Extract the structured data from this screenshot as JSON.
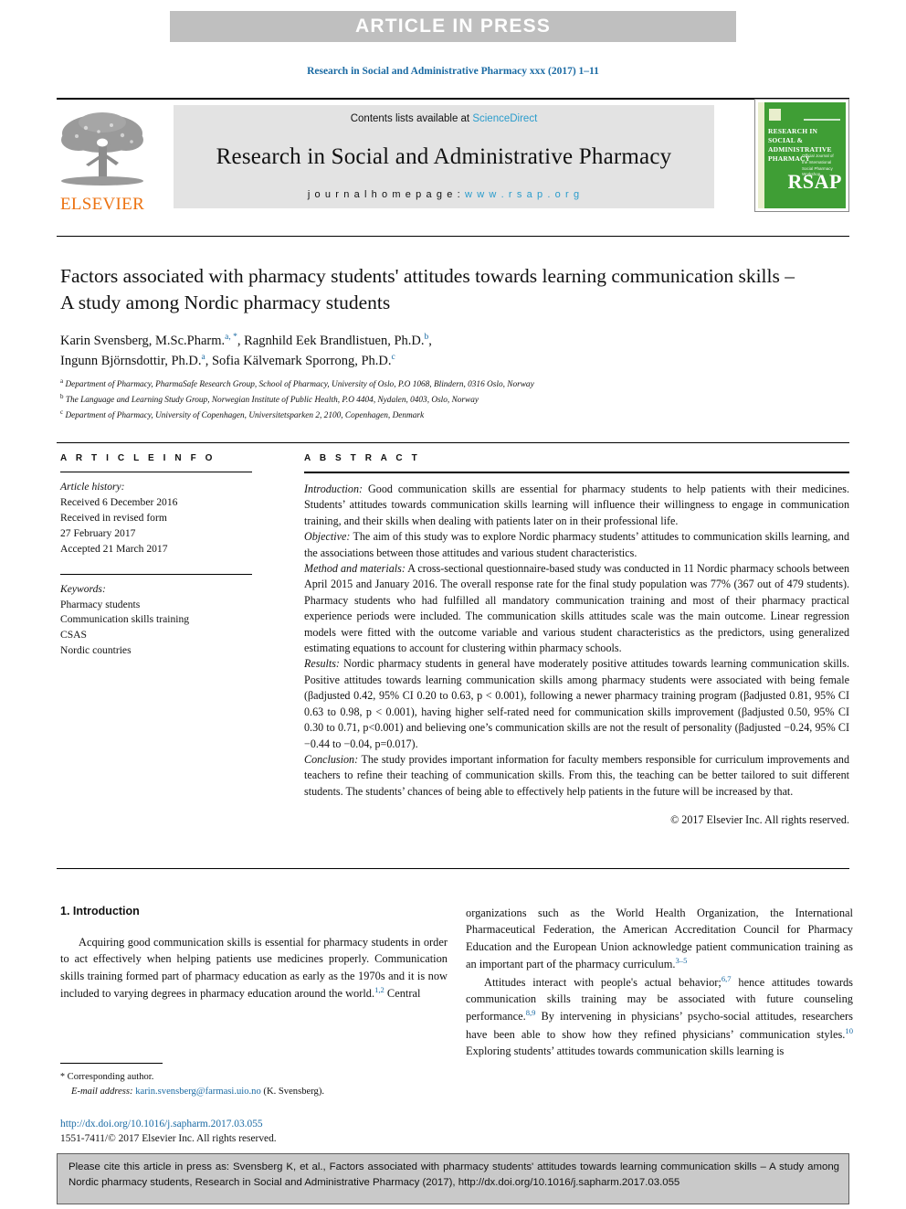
{
  "banner": {
    "text": "ARTICLE IN PRESS"
  },
  "running_head": "Research in Social and Administrative Pharmacy xxx (2017) 1–11",
  "masthead": {
    "contents_prefix": "Contents lists available at ",
    "sciencedirect": "ScienceDirect",
    "journal_title": "Research in Social and Administrative Pharmacy",
    "homepage_prefix": "j o u r n a l   h o m e p a g e :   ",
    "homepage_url": "w w w . r s a p . o r g",
    "publisher": "ELSEVIER",
    "cover": {
      "title": "RESEARCH IN SOCIAL & ADMINISTRATIVE PHARMACY",
      "subtitle": "Official Journal of the International Social Pharmacy Workshop",
      "acronym": "RSAP"
    },
    "colors": {
      "link_blue": "#2a9ccc",
      "elsevier_orange": "#ec7211",
      "cover_green": "#3f9e35",
      "banner_grey": "#bfbfbf"
    }
  },
  "article": {
    "title": "Factors associated with pharmacy students' attitudes towards learning communication skills – A study among Nordic pharmacy students",
    "authors_line_1_a": "Karin Svensberg, M.Sc.Pharm.",
    "authors_line_1_sup1": "a, *",
    "authors_line_1_b": ", Ragnhild Eek Brandlistuen, Ph.D.",
    "authors_line_1_sup2": "b",
    "authors_line_1_c": ",",
    "authors_line_2_a": "Ingunn Björnsdottir, Ph.D.",
    "authors_line_2_sup1": "a",
    "authors_line_2_b": ", Sofia Kälvemark Sporrong, Ph.D.",
    "authors_line_2_sup2": "c",
    "affiliations": [
      {
        "marker": "a",
        "text": "Department of Pharmacy, PharmaSafe Research Group, School of Pharmacy, University of Oslo, P.O 1068, Blindern, 0316 Oslo, Norway"
      },
      {
        "marker": "b",
        "text": "The Language and Learning Study Group, Norwegian Institute of Public Health, P.O 4404, Nydalen, 0403, Oslo, Norway"
      },
      {
        "marker": "c",
        "text": "Department of Pharmacy, University of Copenhagen, Universitetsparken 2, 2100, Copenhagen, Denmark"
      }
    ]
  },
  "article_info": {
    "heading": "A R T I C L E   I N F O",
    "history_label": "Article history:",
    "history": [
      "Received 6 December 2016",
      "Received in revised form",
      "27 February 2017",
      "Accepted 21 March 2017"
    ],
    "keywords_label": "Keywords:",
    "keywords": [
      "Pharmacy students",
      "Communication skills training",
      "CSAS",
      "Nordic countries"
    ]
  },
  "abstract": {
    "heading": "A B S T R A C T",
    "sections": [
      {
        "label": "Introduction:",
        "text": " Good communication skills are essential for pharmacy students to help patients with their medicines. Students’ attitudes towards communication skills learning will influence their willingness to engage in communication training, and their skills when dealing with patients later on in their professional life."
      },
      {
        "label": "Objective:",
        "text": " The aim of this study was to explore Nordic pharmacy students’ attitudes to communication skills learning, and the associations between those attitudes and various student characteristics."
      },
      {
        "label": "Method and materials:",
        "text": " A cross-sectional questionnaire-based study was conducted in 11 Nordic pharmacy schools between April 2015 and January 2016. The overall response rate for the final study population was 77% (367 out of 479 students). Pharmacy students who had fulfilled all mandatory communication training and most of their pharmacy practical experience periods were included. The communication skills attitudes scale was the main outcome. Linear regression models were fitted with the outcome variable and various student characteristics as the predictors, using generalized estimating equations to account for clustering within pharmacy schools."
      },
      {
        "label": "Results:",
        "text": " Nordic pharmacy students in general have moderately positive attitudes towards learning communication skills. Positive attitudes towards learning communication skills among pharmacy students were associated with being female (βadjusted 0.42, 95% CI 0.20 to 0.63, p < 0.001), following a newer pharmacy training program (βadjusted 0.81, 95% CI 0.63 to 0.98, p < 0.001), having higher self-rated need for communication skills improvement (βadjusted 0.50, 95% CI 0.30 to 0.71, p<0.001) and believing one’s communication skills are not the result of personality (βadjusted −0.24, 95% CI −0.44 to −0.04, p=0.017)."
      },
      {
        "label": "Conclusion:",
        "text": " The study provides important information for faculty members responsible for curriculum improvements and teachers to refine their teaching of communication skills. From this, the teaching can be better tailored to suit different students. The students’ chances of being able to effectively help patients in the future will be increased by that."
      }
    ],
    "copyright": "© 2017 Elsevier Inc. All rights reserved."
  },
  "introduction": {
    "heading": "1.  Introduction",
    "left_paragraph": "Acquiring good communication skills is essential for pharmacy students in order to act effectively when helping patients use medicines properly. Communication skills training formed part of pharmacy education as early as the 1970s and it is now included to varying degrees in pharmacy education around the world.",
    "left_ref": "1,2",
    "left_tail": " Central",
    "right_paragraph_1": "organizations such as the World Health Organization, the International Pharmaceutical Federation, the American Accreditation Council for Pharmacy Education and the European Union acknowledge patient communication training as an important part of the pharmacy curriculum.",
    "right_ref_1": "3–5",
    "right_paragraph_2a": "Attitudes interact with people's actual behavior;",
    "right_ref_2": "6,7",
    "right_paragraph_2b": " hence attitudes towards communication skills training may be associated with future counseling performance.",
    "right_ref_3": "8,9",
    "right_paragraph_2c": " By intervening in physicians’ psycho-social attitudes, researchers have been able to show how they refined physicians’ communication styles.",
    "right_ref_4": "10",
    "right_paragraph_2d": " Exploring students’ attitudes towards communication skills learning is"
  },
  "footnote": {
    "corresponding": "Corresponding author.",
    "email_label": "E-mail address:",
    "email": "karin.svensberg@farmasi.uio.no",
    "email_suffix": " (K. Svensberg)."
  },
  "doi_block": {
    "doi_url": "http://dx.doi.org/10.1016/j.sapharm.2017.03.055",
    "issn_line": "1551-7411/© 2017 Elsevier Inc. All rights reserved."
  },
  "cite_box": {
    "text": "Please cite this article in press as: Svensberg K, et al., Factors associated with pharmacy students' attitudes towards learning communication skills – A study among Nordic pharmacy students, Research in Social and Administrative Pharmacy (2017), http://dx.doi.org/10.1016/j.sapharm.2017.03.055"
  }
}
